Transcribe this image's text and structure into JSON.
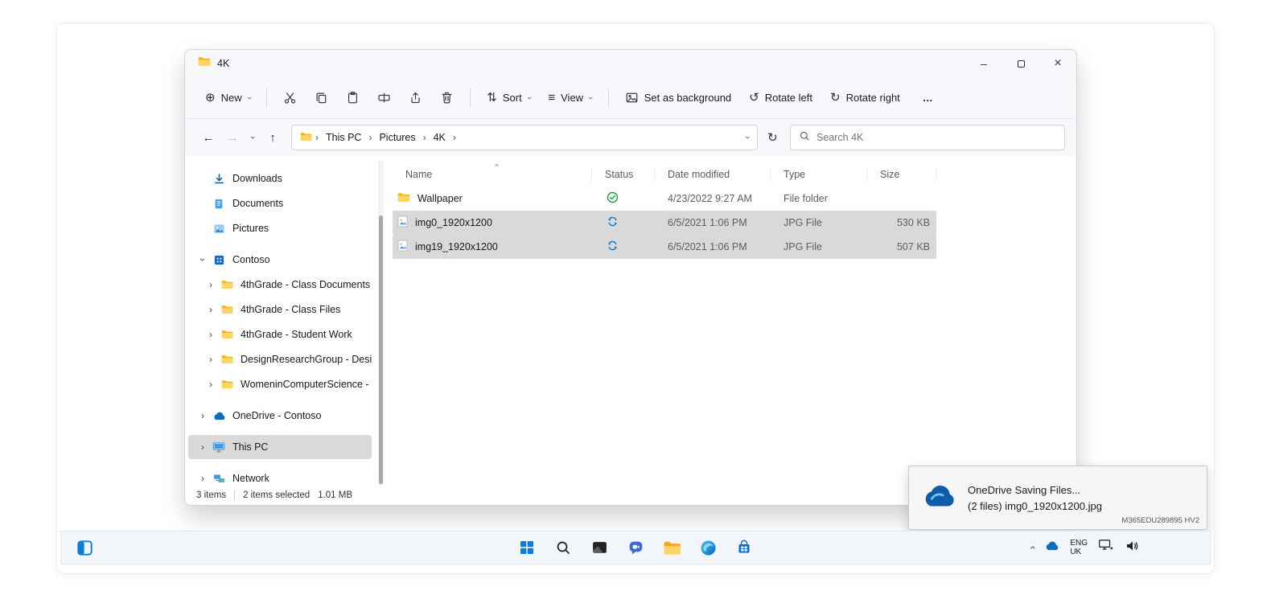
{
  "colors": {
    "accent": "#0078d4",
    "folder_yellow": "#ffd463",
    "selection_gray": "#d9d9d9",
    "sync_green": "#189a43",
    "window_chrome": "#f6f8fc"
  },
  "window": {
    "title": "4K"
  },
  "icons": {
    "new_plus": "⊕",
    "chevron": "›",
    "more": "…",
    "back": "←",
    "forward": "→",
    "up": "↑",
    "refresh": "↻",
    "rotate_left": "↺",
    "rotate_right": "↻",
    "sort": "⇅",
    "view": "≡",
    "minimize": "–",
    "close": "×"
  },
  "toolbar": {
    "new": "New",
    "sort": "Sort",
    "view": "View",
    "set_as_background": "Set as background",
    "rotate_left": "Rotate left",
    "rotate_right": "Rotate right"
  },
  "address": {
    "crumbs": [
      "This PC",
      "Pictures",
      "4K"
    ],
    "search_placeholder": "Search 4K"
  },
  "sidebar": {
    "items": [
      {
        "label": "Downloads"
      },
      {
        "label": "Documents"
      },
      {
        "label": "Pictures"
      },
      {
        "label": "Contoso"
      },
      {
        "label": "4thGrade - Class Documents"
      },
      {
        "label": "4thGrade - Class Files"
      },
      {
        "label": "4thGrade - Student Work"
      },
      {
        "label": "DesignResearchGroup - Design Re"
      },
      {
        "label": "WomeninComputerScience - Man"
      },
      {
        "label": "OneDrive - Contoso"
      },
      {
        "label": "This PC"
      },
      {
        "label": "Network"
      }
    ]
  },
  "files": {
    "columns": {
      "name": "Name",
      "status": "Status",
      "date": "Date modified",
      "type": "Type",
      "size": "Size"
    },
    "rows": [
      {
        "name": "Wallpaper",
        "date": "4/23/2022 9:27 AM",
        "type": "File folder",
        "size": ""
      },
      {
        "name": "img0_1920x1200",
        "date": "6/5/2021 1:06 PM",
        "type": "JPG File",
        "size": "530 KB"
      },
      {
        "name": "img19_1920x1200",
        "date": "6/5/2021 1:06 PM",
        "type": "JPG File",
        "size": "507 KB"
      }
    ]
  },
  "statusbar": {
    "count": "3 items",
    "selected": "2 items selected",
    "size": "1.01 MB"
  },
  "toast": {
    "title": "OneDrive Saving Files...",
    "detail": "(2 files) img0_1920x1200.jpg",
    "device": "M365EDU289895 HV2"
  },
  "tray": {
    "lang1": "ENG",
    "lang2": "UK"
  }
}
